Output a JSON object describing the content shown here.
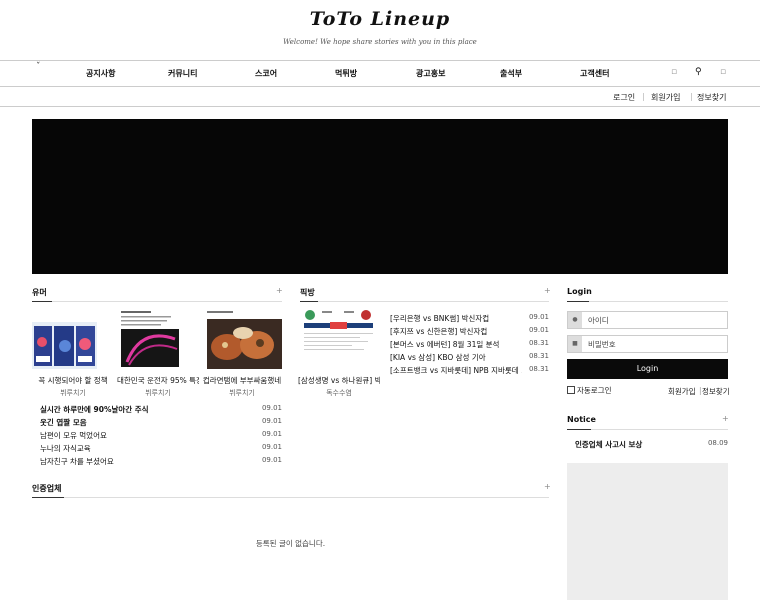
{
  "header": {
    "logo": "ToTo Lineup",
    "tagline": "Welcome! We hope share stories with you in this place"
  },
  "nav": {
    "items": [
      "공지사항",
      "커뮤니티",
      "스코어",
      "먹튀방",
      "광고홍보",
      "출석부",
      "고객센터"
    ]
  },
  "subbar": {
    "login": "로그인",
    "signup": "회원가입",
    "find": "정보찾기"
  },
  "humor": {
    "title": "유머",
    "cards": [
      {
        "caption": "꼭 시행되어야 할 정책",
        "author": "뷔루치기"
      },
      {
        "caption": "대한민국 운전자 95% 특징",
        "author": "뷔루치기"
      },
      {
        "caption": "컵라면탬에 부부싸움했네",
        "author": "뷔루치기"
      }
    ],
    "list": [
      {
        "title": "실시간 하루만에 90%날아간 주식",
        "date": "09.01"
      },
      {
        "title": "웃긴 엽짤 모음",
        "date": "09.01"
      },
      {
        "title": "남편이 모유 먹었어요",
        "date": "09.01"
      },
      {
        "title": "누나의 자식교육",
        "date": "09.01"
      },
      {
        "title": "남자친구 차를 부셨어요",
        "date": "09.01"
      }
    ]
  },
  "pick": {
    "title": "픽방",
    "card": {
      "caption": "[삼성생명 vs 하나원큐] 박",
      "author": "독수수염"
    },
    "list": [
      {
        "title": "[우리은행 vs BNK썸] 박신자컵",
        "date": "09.01"
      },
      {
        "title": "[후지쯔 vs 신한은행] 박신자컵",
        "date": "09.01"
      },
      {
        "title": "[본머스 vs 에버턴] 8월 31일 분석",
        "date": "08.31"
      },
      {
        "title": "[KIA vs 삼성] KBO 삼성 기아",
        "date": "08.31"
      },
      {
        "title": "[소프트뱅크 vs 지바롯데] NPB 지바롯데 ...",
        "date": "08.31"
      }
    ]
  },
  "certified": {
    "title": "인증업체",
    "empty": "등록된 글이 없습니다."
  },
  "login": {
    "title": "Login",
    "id_placeholder": "아이디",
    "pw_placeholder": "비밀번호",
    "button": "Login",
    "auto": "자동로그인",
    "signup": "회원가입",
    "find": "정보찾기"
  },
  "notice": {
    "title": "Notice",
    "items": [
      {
        "title": "인증업체 사고시 보상",
        "date": "08.09"
      }
    ]
  }
}
